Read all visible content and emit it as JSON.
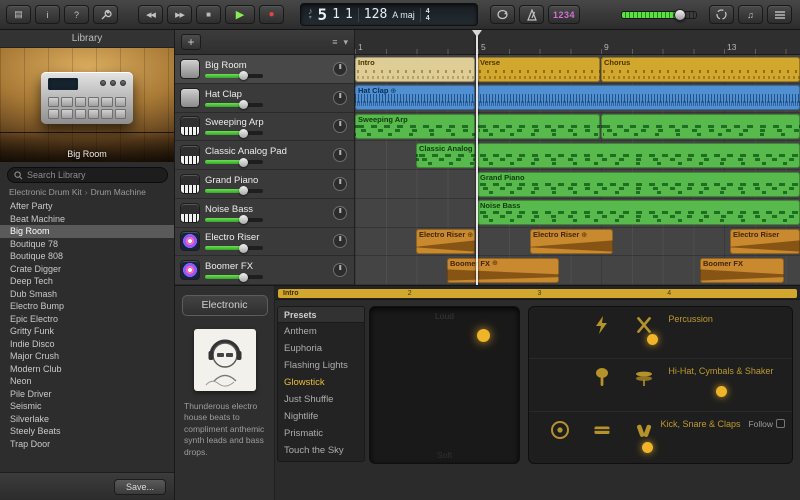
{
  "icons": {
    "library": "▤",
    "info": "i",
    "help": "?",
    "rewind": "◀◀",
    "forward": "▶▶",
    "stop": "■",
    "play": "▶",
    "record": "●",
    "note": "♪",
    "chev_down": "▾",
    "plus": "+",
    "menu": "≡",
    "media": "♫"
  },
  "toolbar": {
    "lcd": {
      "bar": "5",
      "beat": "1",
      "division": "1",
      "tempo": "128",
      "key": "A maj",
      "time_top": "4",
      "time_bottom": "4"
    },
    "count_in": "1234"
  },
  "library": {
    "title": "Library",
    "instrument": "Big Room",
    "search_placeholder": "Search Library",
    "breadcrumb": [
      "Electronic Drum Kit",
      "Drum Machine"
    ],
    "breadcrumb_sep": "›",
    "items": [
      "After Party",
      "Beat Machine",
      "Big Room",
      "Boutique 78",
      "Boutique 808",
      "Crate Digger",
      "Deep Tech",
      "Dub Smash",
      "Electro Bump",
      "Epic Electro",
      "Gritty Funk",
      "Indie Disco",
      "Major Crush",
      "Modern Club",
      "Neon",
      "Pile Driver",
      "Seismic",
      "Silverlake",
      "Steely Beats",
      "Trap Door"
    ],
    "save_button": "Save..."
  },
  "tracks": [
    {
      "name": "Big Room"
    },
    {
      "name": "Hat Clap"
    },
    {
      "name": "Sweeping Arp"
    },
    {
      "name": "Classic Analog Pad"
    },
    {
      "name": "Grand Piano"
    },
    {
      "name": "Noise Bass"
    },
    {
      "name": "Electro Riser"
    },
    {
      "name": "Boomer FX"
    }
  ],
  "timeline": {
    "ruler_marks": [
      "1",
      "5",
      "9",
      "13"
    ],
    "loop_badge": "⊕",
    "regions": [
      {
        "label": "Intro"
      },
      {
        "label": "Verse"
      },
      {
        "label": "Chorus"
      },
      {
        "label": "Hat Clap"
      },
      {
        "label": "Sweeping Arp"
      },
      {
        "label": "Classic Analog Pad"
      },
      {
        "label": "Grand Piano"
      },
      {
        "label": "Noise Bass"
      },
      {
        "label": "Electro Riser"
      },
      {
        "label": "Electro Riser"
      },
      {
        "label": "Electro Riser"
      },
      {
        "label": "Boomer FX"
      },
      {
        "label": "Boomer FX"
      }
    ]
  },
  "smart_controls": {
    "category": "Electronic",
    "description": "Thunderous electro house beats to compliment anthemic synth leads and bass drops.",
    "mini_ruler": {
      "region": "Intro",
      "marks": [
        "2",
        "3",
        "4"
      ]
    },
    "presets_header": "Presets",
    "presets": [
      "Anthem",
      "Euphoria",
      "Flashing Lights",
      "Glowstick",
      "Just Shuffle",
      "Nightlife",
      "Prismatic",
      "Touch the Sky"
    ],
    "selected_preset": "Glowstick",
    "xy_pad": {
      "top": "Loud",
      "bottom": "Soft"
    },
    "groups": [
      {
        "label": "Percussion"
      },
      {
        "label": "Hi-Hat, Cymbals & Shaker"
      },
      {
        "label": "Kick, Snare & Claps",
        "follow": "Follow"
      }
    ]
  },
  "colors": {
    "region_yellow": "#d2a72e",
    "region_blue": "#4f8fd2",
    "region_green": "#58b94c",
    "region_orange": "#c8892f",
    "accent_yellow": "#f0b429",
    "play_green": "#86ef4f",
    "record_red": "#e84343"
  }
}
